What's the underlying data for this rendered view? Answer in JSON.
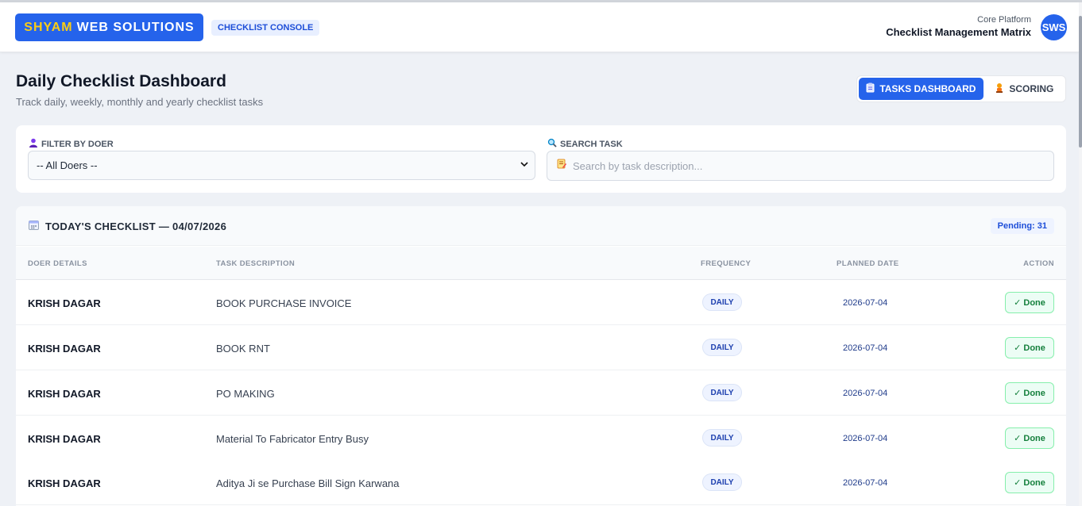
{
  "header": {
    "brand_accent": "SHYAM",
    "brand_rest": "WEB SOLUTIONS",
    "console_badge": "CHECKLIST CONSOLE",
    "platform_label": "Core Platform",
    "platform_title": "Checklist Management Matrix",
    "avatar_initials": "SWS"
  },
  "page": {
    "title": "Daily Checklist Dashboard",
    "subtitle": "Track daily, weekly, monthly and yearly checklist tasks"
  },
  "tabs": [
    {
      "label": "TASKS DASHBOARD",
      "icon": "clipboard-icon",
      "active": true
    },
    {
      "label": "SCORING",
      "icon": "trophy-icon",
      "active": false
    }
  ],
  "filters": {
    "doer_label": "FILTER BY DOER",
    "doer_value": "-- All Doers --",
    "search_label": "SEARCH TASK",
    "search_placeholder": "Search by task description..."
  },
  "checklist": {
    "title": "TODAY'S CHECKLIST — 04/07/2026",
    "pending": "Pending: 31",
    "columns": [
      "DOER DETAILS",
      "TASK DESCRIPTION",
      "FREQUENCY",
      "PLANNED DATE",
      "ACTION"
    ],
    "rows": [
      {
        "doer": "KRISH DAGAR",
        "task": "BOOK PURCHASE INVOICE",
        "frequency": "DAILY",
        "planned": "2026-07-04",
        "action": "✓ Done"
      },
      {
        "doer": "KRISH DAGAR",
        "task": "BOOK RNT",
        "frequency": "DAILY",
        "planned": "2026-07-04",
        "action": "✓ Done"
      },
      {
        "doer": "KRISH DAGAR",
        "task": "PO MAKING",
        "frequency": "DAILY",
        "planned": "2026-07-04",
        "action": "✓ Done"
      },
      {
        "doer": "KRISH DAGAR",
        "task": "Material To Fabricator Entry Busy",
        "frequency": "DAILY",
        "planned": "2026-07-04",
        "action": "✓ Done"
      },
      {
        "doer": "KRISH DAGAR",
        "task": "Aditya Ji se Purchase Bill Sign Karwana",
        "frequency": "DAILY",
        "planned": "2026-07-04",
        "action": "✓ Done"
      }
    ]
  },
  "colors": {
    "primary": "#2563eb",
    "brand_accent": "#facc15",
    "done_green": "#15803d",
    "page_bg": "#eef1f6"
  }
}
